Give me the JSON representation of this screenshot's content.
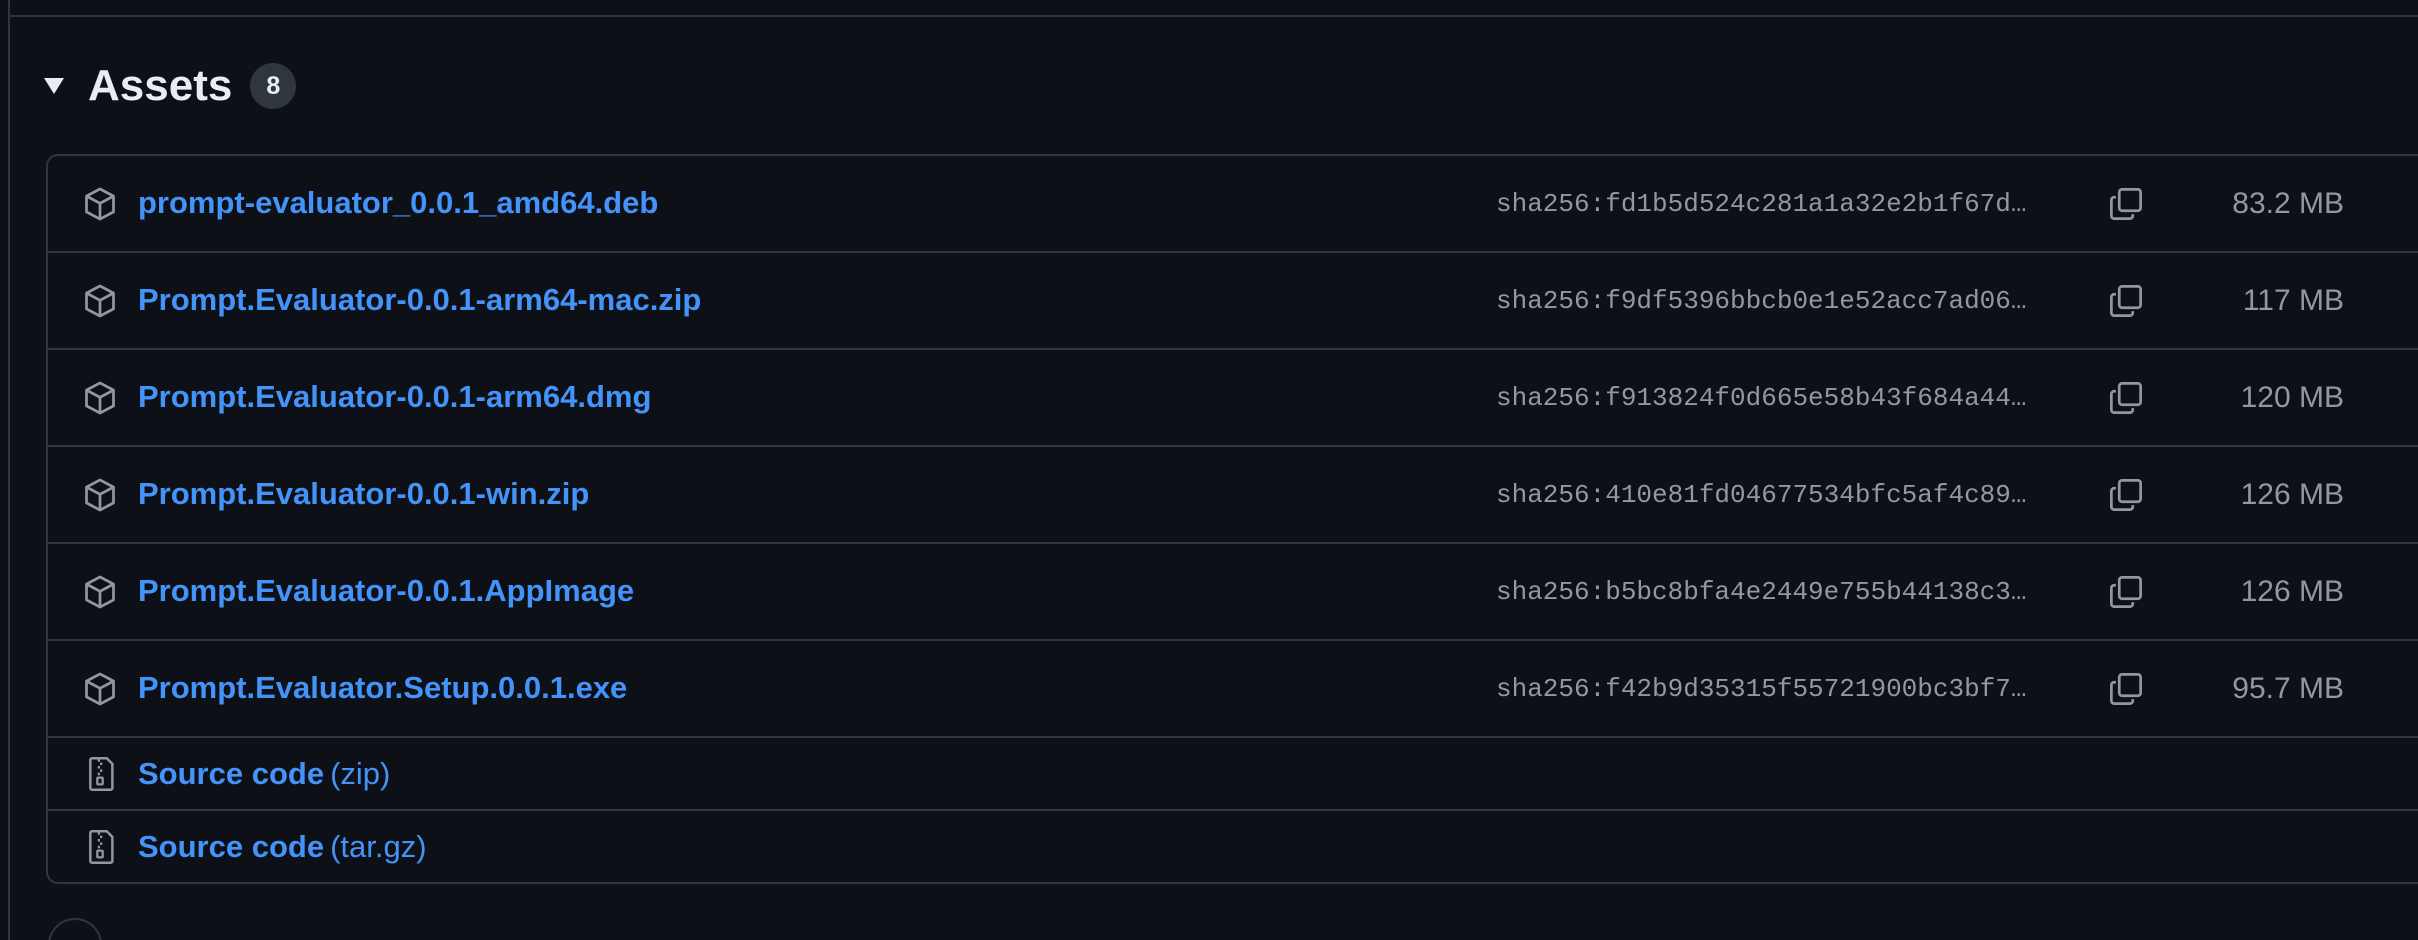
{
  "release": {
    "assets_title": "Assets",
    "assets_count": "8",
    "assets": [
      {
        "name": "prompt-evaluator_0.0.1_amd64.deb",
        "sha": "sha256:fd1b5d524c281a1a32e2b1f67d…",
        "size": "83.2 MB",
        "icon": "package-icon"
      },
      {
        "name": "Prompt.Evaluator-0.0.1-arm64-mac.zip",
        "sha": "sha256:f9df5396bbcb0e1e52acc7ad06…",
        "size": "117 MB",
        "icon": "package-icon"
      },
      {
        "name": "Prompt.Evaluator-0.0.1-arm64.dmg",
        "sha": "sha256:f913824f0d665e58b43f684a44…",
        "size": "120 MB",
        "icon": "package-icon"
      },
      {
        "name": "Prompt.Evaluator-0.0.1-win.zip",
        "sha": "sha256:410e81fd04677534bfc5af4c89…",
        "size": "126 MB",
        "icon": "package-icon"
      },
      {
        "name": "Prompt.Evaluator-0.0.1.AppImage",
        "sha": "sha256:b5bc8bfa4e2449e755b44138c3…",
        "size": "126 MB",
        "icon": "package-icon"
      },
      {
        "name": "Prompt.Evaluator.Setup.0.0.1.exe",
        "sha": "sha256:f42b9d35315f55721900bc3bf7…",
        "size": "95.7 MB",
        "icon": "package-icon"
      }
    ],
    "source_code": [
      {
        "label": "Source code",
        "format": "(zip)",
        "icon": "file-zip-icon"
      },
      {
        "label": "Source code",
        "format": "(tar.gz)",
        "icon": "file-zip-icon"
      }
    ]
  },
  "colors": {
    "background": "#0d1117",
    "border": "#30363d",
    "link": "#4493f8",
    "muted": "#9198a1",
    "text": "#e6edf3"
  }
}
